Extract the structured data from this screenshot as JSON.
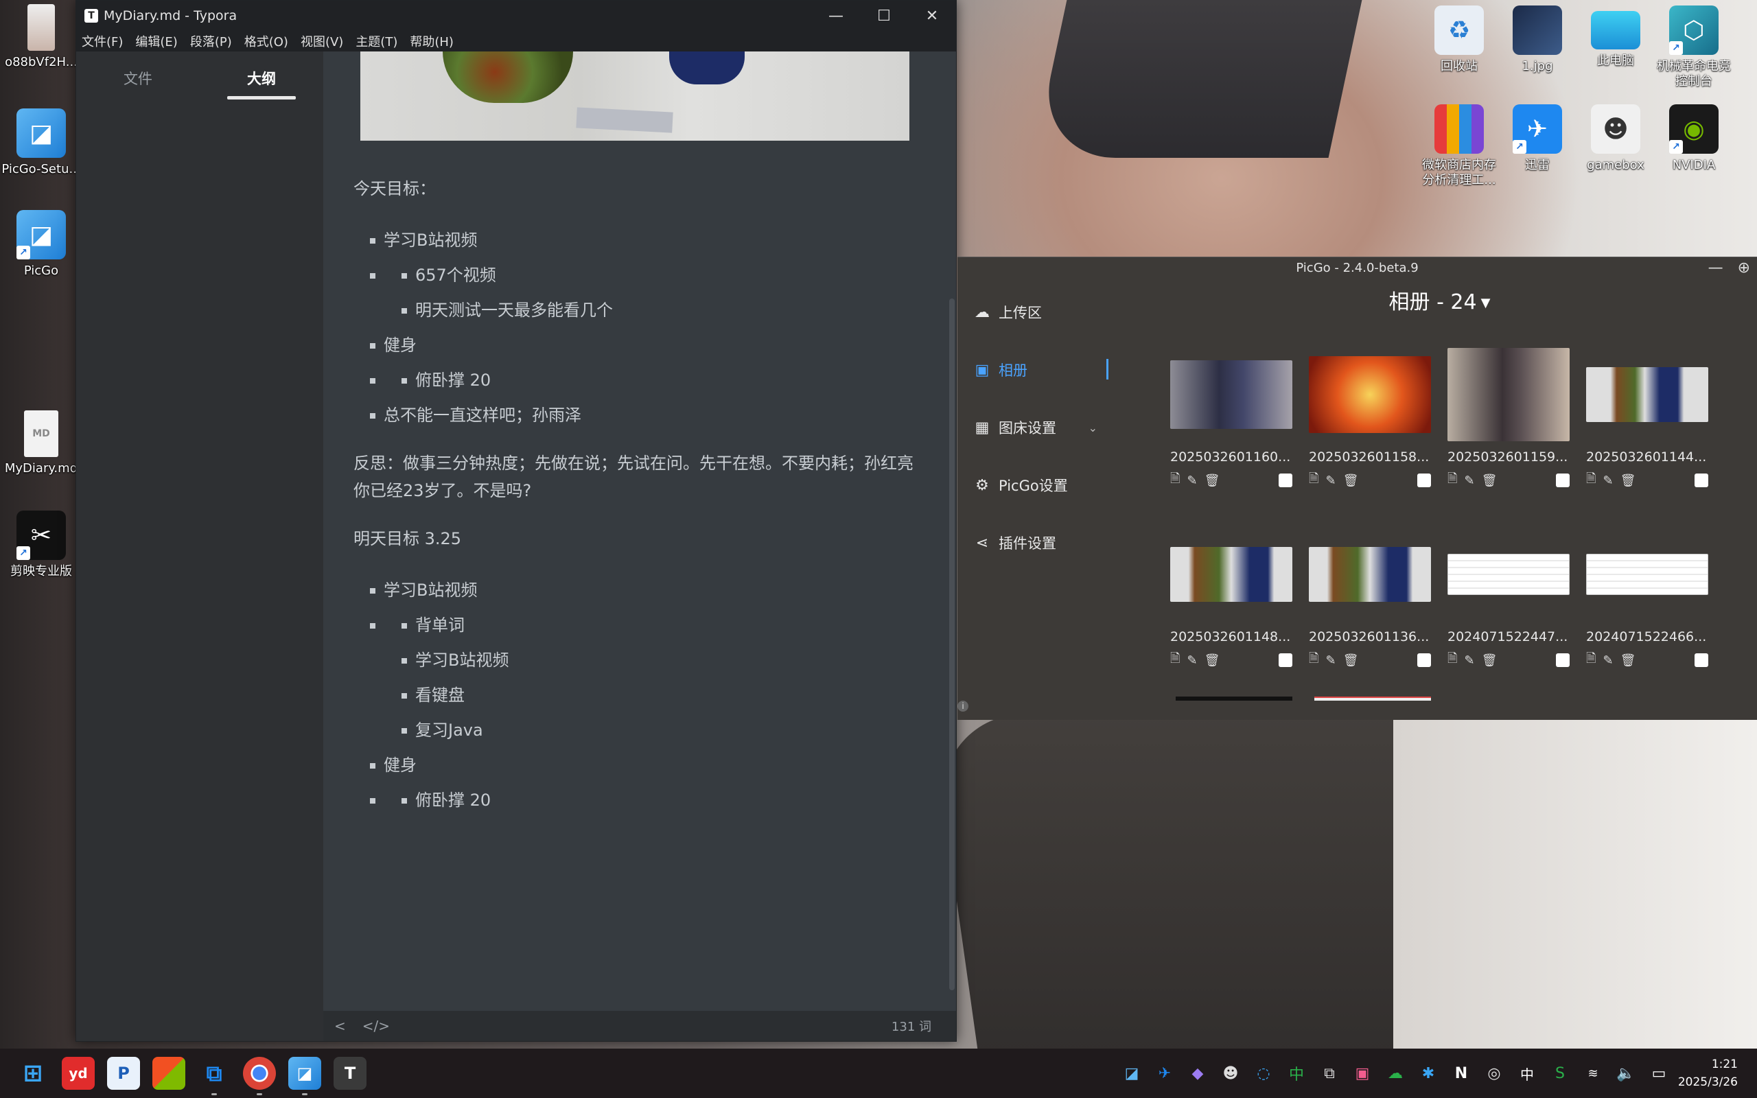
{
  "desktop": {
    "left_icons": [
      {
        "label": "o88bVf2H..."
      },
      {
        "label": "PicGo-Setu..."
      },
      {
        "label": "PicGo"
      },
      {
        "label": "MyDiary.md"
      },
      {
        "label": "剪映专业版"
      }
    ],
    "right_icons": [
      {
        "label": "回收站"
      },
      {
        "label": "1.jpg"
      },
      {
        "label": "此电脑"
      },
      {
        "label": "机械革命电竞控制台"
      },
      {
        "label": "微软商店内存分析清理工..."
      },
      {
        "label": "迅雷"
      },
      {
        "label": "gamebox"
      },
      {
        "label": "NVIDIA"
      }
    ]
  },
  "typora": {
    "title": "MyDiary.md - Typora",
    "app_icon": "T",
    "menu": [
      "文件(F)",
      "编辑(E)",
      "段落(P)",
      "格式(O)",
      "视图(V)",
      "主题(T)",
      "帮助(H)"
    ],
    "sidebar_tabs": {
      "files": "文件",
      "outline": "大纲"
    },
    "content": {
      "p1": "今天目标：",
      "list1": [
        "学习B站视频",
        "657个视频",
        "明天测试一天最多能看几个",
        "健身",
        "俯卧撑 20",
        "总不能一直这样吧；孙雨泽"
      ],
      "p2": "反思：做事三分钟热度；先做在说；先试在问。先干在想。不要内耗；孙红亮你已经23岁了。不是吗?",
      "p3": "明天目标 3.25",
      "list2": [
        "学习B站视频",
        "背单词",
        "学习B站视频",
        "看键盘",
        "复习Java",
        "健身",
        "俯卧撑 20"
      ]
    },
    "status": {
      "back": "<",
      "source": "</>",
      "word_count": "131 词"
    }
  },
  "picgo": {
    "title": "PicGo - 2.4.0-beta.9",
    "nav": {
      "upload": "上传区",
      "album": "相册",
      "bed_settings": "图床设置",
      "picgo_settings": "PicGo设置",
      "plugin_settings": "插件设置"
    },
    "album_title": "相册 - 24",
    "images": [
      {
        "name": "2025032601160..."
      },
      {
        "name": "2025032601158..."
      },
      {
        "name": "2025032601159..."
      },
      {
        "name": "2025032601144..."
      },
      {
        "name": "2025032601148..."
      },
      {
        "name": "2025032601136..."
      },
      {
        "name": "2024071522447..."
      },
      {
        "name": "2024071522466..."
      }
    ]
  },
  "taskbar": {
    "apps": [
      "windows-start-icon",
      "youdao-icon",
      "paypal-icon",
      "store-icon",
      "snipaste-icon",
      "chrome-icon",
      "picgo-icon",
      "typora-icon"
    ],
    "ime": "中",
    "time": "1:21",
    "date": "2025/3/26"
  },
  "colors": {
    "accent": "#4aa3ff",
    "typora_bg": "#363b40",
    "picgo_bg": "#3d3a37"
  }
}
